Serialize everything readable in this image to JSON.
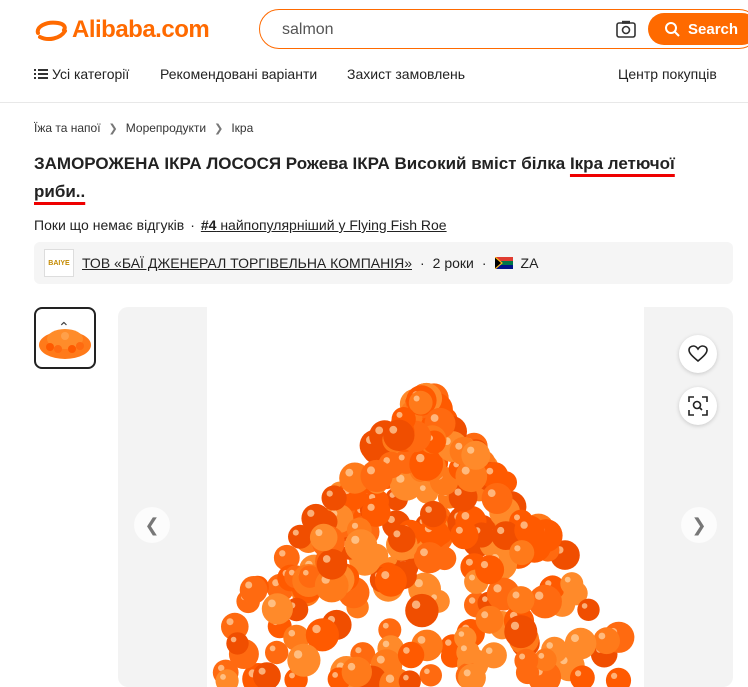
{
  "header": {
    "logo_text": "Alibaba.com",
    "search_value": "salmon",
    "search_button": "Search",
    "accent_color": "#ff6a00"
  },
  "nav": {
    "items": [
      "Усі категорії",
      "Рекомендовані варіанти",
      "Захист замовлень",
      "Центр покупців"
    ]
  },
  "breadcrumbs": [
    "Їжа та напої",
    "Морепродукти",
    "Ікра"
  ],
  "product": {
    "title_part1": "ЗАМОРОЖЕНА ІКРА ЛОСОСЯ Рожева ІКРА Високий вміст білка ",
    "title_underlined1": "Ікра летючої",
    "title_underlined2": "риби..",
    "reviews_text": "Поки що немає відгуків",
    "dot": "·",
    "rank_number": "#4",
    "rank_text": " найпопулярніший у Flying Fish Roe"
  },
  "supplier": {
    "logo_text": "BAIYE",
    "name": "ТОВ «БАЇ ДЖЕНЕРАЛ ТОРГІВЕЛЬНА КОМПАНІЯ»",
    "years": "2 роки",
    "country": "ZA"
  },
  "gallery": {
    "icons": [
      "heart-icon",
      "image-search-icon",
      "chevron-left-icon",
      "chevron-right-icon",
      "chevron-up-icon"
    ]
  }
}
